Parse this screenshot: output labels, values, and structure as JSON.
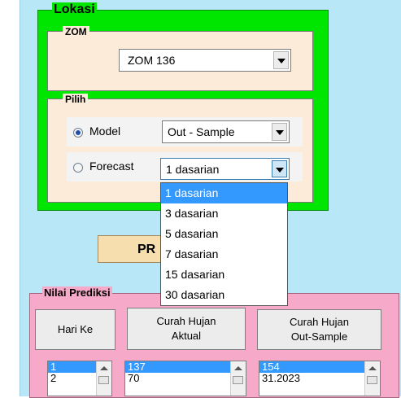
{
  "lokasi": {
    "title": "Lokasi",
    "zom": {
      "title": "ZOM",
      "selected": "ZOM 136"
    },
    "pilih": {
      "title": "Pilih",
      "model_label": "Model",
      "model_checked": true,
      "model_value": "Out - Sample",
      "forecast_label": "Forecast",
      "forecast_checked": false,
      "forecast_value": "1 dasarian"
    }
  },
  "dropdown": {
    "options": [
      "1 dasarian",
      "3 dasarian",
      "5 dasarian",
      "7 dasarian",
      "15 dasarian",
      "30 dasarian"
    ],
    "selected_index": 0
  },
  "predict_button": {
    "label": "PR"
  },
  "nilai": {
    "title": "Nilai Prediksi",
    "headers": {
      "hari": "Hari Ke",
      "aktual": "Curah Hujan\nAktual",
      "outsample": "Curah Hujan\nOut-Sample"
    },
    "hari_values": [
      "1",
      "2"
    ],
    "aktual_values": [
      "137",
      "70"
    ],
    "outsample_values": [
      "154",
      "31.2023"
    ]
  },
  "colors": {
    "background": "#b8e8f7",
    "lokasi_group": "#00e600",
    "inner_panel": "#fbebd8",
    "nilai_panel": "#f7a9c9",
    "selection": "#3399ff",
    "predict_button": "#f6deaf"
  }
}
